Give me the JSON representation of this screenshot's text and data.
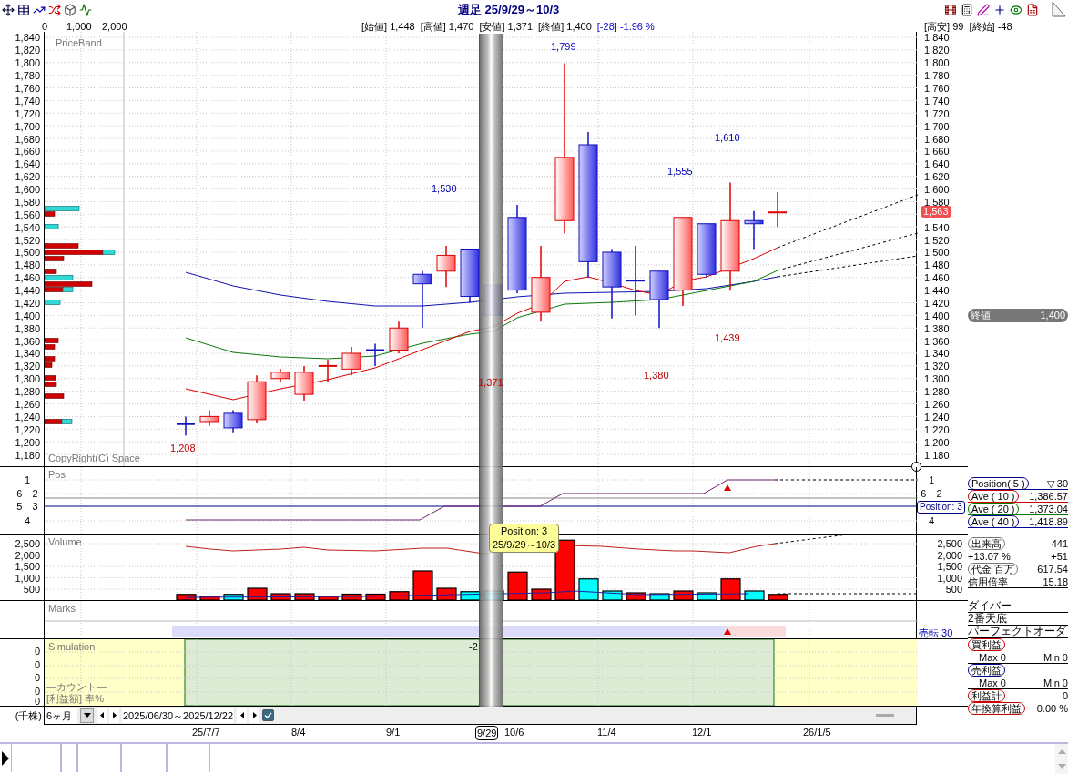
{
  "header": {
    "title": "週足 25/9/29～10/3"
  },
  "quote": {
    "band_ticks": [
      "0",
      "1,000",
      "2,000"
    ],
    "items": [
      {
        "text": "[始値] 1,448",
        "kind": "plain"
      },
      {
        "text": "[高値] 1,470",
        "kind": "plain"
      },
      {
        "text": "[安値] 1,371",
        "kind": "plain"
      },
      {
        "text": "[終値] 1,400",
        "kind": "plain"
      },
      {
        "text": "[-28] -1.96 %",
        "kind": "change"
      }
    ],
    "range_info": "[高安] 99  [終始] -48"
  },
  "price_chart": {
    "title": "PriceBand",
    "footer": "CopyRight(C) Space",
    "left_ticks": [
      "1,840",
      "1,820",
      "1,800",
      "1,780",
      "1,760",
      "1,740",
      "1,720",
      "1,700",
      "1,680",
      "1,660",
      "1,640",
      "1,620",
      "1,600",
      "1,580",
      "1,560",
      "1,540",
      "1,520",
      "1,500",
      "1,480",
      "1,460",
      "1,440",
      "1,420",
      "1,400",
      "1,380",
      "1,360",
      "1,340",
      "1,320",
      "1,300",
      "1,280",
      "1,260",
      "1,240",
      "1,220",
      "1,200",
      "1,180"
    ],
    "right_ticks": [
      "1,840",
      "1,820",
      "1,800",
      "1,780",
      "1,760",
      "1,740",
      "1,720",
      "1,700",
      "1,680",
      "1,660",
      "1,640",
      "1,620",
      "1,600",
      "1,580",
      "1,540",
      "1,520",
      "1,500",
      "1,480",
      "1,460",
      "1,440",
      "1,420",
      "1,400",
      "1,380",
      "1,360",
      "1,340",
      "1,320",
      "1,300",
      "1,280",
      "1,260",
      "1,240",
      "1,220",
      "1,200",
      "1,180"
    ],
    "annotations": [
      {
        "text": "1,799",
        "kind": "high"
      },
      {
        "text": "1,530",
        "kind": "high"
      },
      {
        "text": "1,555",
        "kind": "high"
      },
      {
        "text": "1,610",
        "kind": "high"
      },
      {
        "text": "1,208",
        "kind": "low"
      },
      {
        "text": "1,371",
        "kind": "low"
      },
      {
        "text": "1,380",
        "kind": "low"
      },
      {
        "text": "1,439",
        "kind": "low"
      }
    ],
    "last_price": "1,563",
    "close_badge": {
      "label": "終値",
      "value": "1,400"
    }
  },
  "pos_panel": {
    "title": "Pos",
    "left_labels": [
      "1",
      "6 2",
      "5 3",
      "4"
    ],
    "right_labels": [
      "1",
      "6 2",
      "4"
    ],
    "position_tag": "Position: 3"
  },
  "tooltip": {
    "lines": [
      "Position: 3",
      "25/9/29～10/3"
    ]
  },
  "volume_panel": {
    "title": "Volume",
    "left_ticks": [
      "2,500",
      "2,000",
      "1,500",
      "1,000",
      "500"
    ],
    "right_ticks": [
      "2,500",
      "2,000",
      "1,500",
      "1,000",
      "500"
    ]
  },
  "marks_panel": {
    "title": "Marks",
    "signal": "売転 30"
  },
  "simulation_panel": {
    "title": "Simulation",
    "zero_labels": [
      "0",
      "0",
      "0",
      "0",
      "0"
    ],
    "marker": "-2",
    "count_label": "―カウント―",
    "profit_label": "[利益額] 率%"
  },
  "controls": {
    "unit": "(千株)",
    "period": "6ヶ月",
    "range": "2025/06/30～2025/12/22",
    "checked": true
  },
  "dates": [
    {
      "label": "25/7/7",
      "selected": false
    },
    {
      "label": "8/4",
      "selected": false
    },
    {
      "label": "9/1",
      "selected": false
    },
    {
      "label": "9/29",
      "selected": true
    },
    {
      "label": "10/6",
      "selected": false
    },
    {
      "label": "11/4",
      "selected": false
    },
    {
      "label": "12/1",
      "selected": false
    },
    {
      "label": "26/1/5",
      "selected": false
    }
  ],
  "averages": [
    {
      "label": "Position( 5 )",
      "value": "▽ 30",
      "color": "#000080"
    },
    {
      "label": "Ave ( 10 )",
      "value": "1,386.57",
      "color": "#cc0000"
    },
    {
      "label": "Ave ( 20 )",
      "value": "1,373.04",
      "color": "#007700"
    },
    {
      "label": "Ave ( 40 )",
      "value": "1,418.89",
      "color": "#000099"
    }
  ],
  "stats": [
    {
      "label": "出来高",
      "value": "441",
      "kind": "pill"
    },
    {
      "label": "+13.07 %",
      "value": "+51",
      "kind": "plain"
    },
    {
      "label": "代金 百万",
      "value": "617.54",
      "kind": "pill"
    },
    {
      "label": "信用倍率",
      "value": "15.18",
      "kind": "underline"
    }
  ],
  "signals": [
    "ダイバー",
    "2番天底",
    "パーフェクトオーダ"
  ],
  "profit": [
    {
      "kind": "pill",
      "label": "買利益",
      "color": "#cc0000"
    },
    {
      "kind": "range",
      "max": "Max 0",
      "min": "Min 0"
    },
    {
      "kind": "pill",
      "label": "売利益",
      "color": "#000099"
    },
    {
      "kind": "range",
      "max": "Max 0",
      "min": "Min 0"
    },
    {
      "kind": "pill",
      "label": "利益計",
      "value": "0",
      "color": "#cc0000"
    },
    {
      "kind": "pill",
      "label": "年換算利益",
      "value": "0.00 %",
      "color": "#cc0000"
    }
  ]
}
